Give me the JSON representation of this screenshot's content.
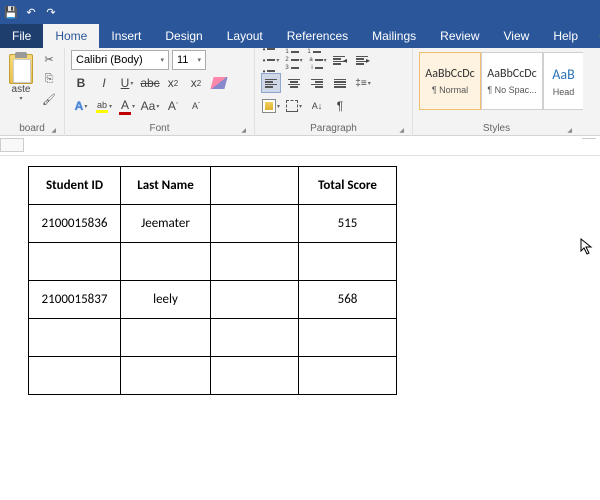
{
  "qat": {
    "save": "💾",
    "undo": "↶",
    "redo": "↷"
  },
  "tabs": {
    "file": "File",
    "home": "Home",
    "insert": "Insert",
    "design": "Design",
    "layout": "Layout",
    "references": "References",
    "mailings": "Mailings",
    "review": "Review",
    "view": "View",
    "help": "Help"
  },
  "ribbon": {
    "clipboard": {
      "label": "board",
      "paste": "aste"
    },
    "font": {
      "label": "Font",
      "name": "Calibri (Body)",
      "size": "11",
      "bold": "B",
      "italic": "I",
      "underline": "U",
      "strike": "abc",
      "sub": "x",
      "sup": "x",
      "texteffects": "A",
      "highlight": "ab",
      "fontcolor": "A",
      "charcase": "Aa",
      "grow": "A",
      "shrink": "A"
    },
    "paragraph": {
      "label": "Paragraph",
      "sort": "A↓",
      "pilcrow": "¶"
    },
    "styles": {
      "label": "Styles",
      "preview": "AaBbCcDc",
      "preview_heading": "AaB",
      "items": [
        {
          "name": "¶ Normal"
        },
        {
          "name": "¶ No Spac..."
        },
        {
          "name": "Head"
        }
      ]
    }
  },
  "table": {
    "headers": [
      "Student ID",
      "Last Name",
      "",
      "Total Score"
    ],
    "rows": [
      [
        "2100015836",
        "Jeemater",
        "",
        "515"
      ],
      [
        "",
        "",
        "",
        ""
      ],
      [
        "2100015837",
        "leely",
        "",
        "568"
      ],
      [
        "",
        "",
        "",
        ""
      ],
      [
        "",
        "",
        "",
        ""
      ]
    ]
  }
}
